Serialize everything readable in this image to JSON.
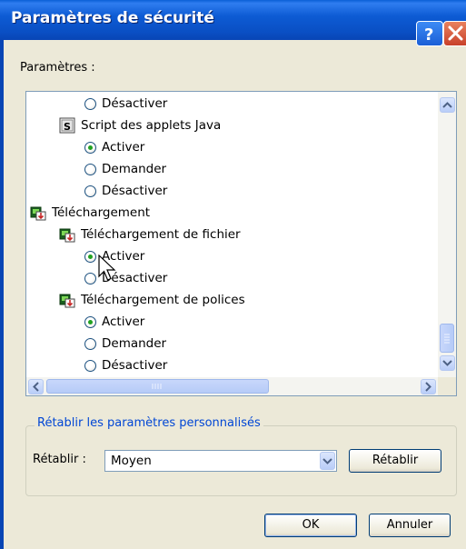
{
  "window": {
    "title": "Paramètres de sécurité"
  },
  "title_buttons": {
    "help": "help-icon",
    "close": "close-icon"
  },
  "settings_label": "Paramètres :",
  "tree": [
    {
      "kind": "radio",
      "label": "Désactiver",
      "checked": false,
      "indent": 1
    },
    {
      "kind": "category",
      "label": "Script des applets Java",
      "icon": "script-icon",
      "indent": 0
    },
    {
      "kind": "radio",
      "label": "Activer",
      "checked": true,
      "indent": 1
    },
    {
      "kind": "radio",
      "label": "Demander",
      "checked": false,
      "indent": 1
    },
    {
      "kind": "radio",
      "label": "Désactiver",
      "checked": false,
      "indent": 1
    },
    {
      "kind": "category",
      "label": "Téléchargement",
      "icon": "download-icon",
      "indent": -1
    },
    {
      "kind": "category",
      "label": "Téléchargement de fichier",
      "icon": "download-icon",
      "indent": 0
    },
    {
      "kind": "radio",
      "label": "Activer",
      "checked": true,
      "indent": 1
    },
    {
      "kind": "radio",
      "label": "Désactiver",
      "checked": false,
      "indent": 1
    },
    {
      "kind": "category",
      "label": "Téléchargement de polices",
      "icon": "download-icon",
      "indent": 0
    },
    {
      "kind": "radio",
      "label": "Activer",
      "checked": true,
      "indent": 1
    },
    {
      "kind": "radio",
      "label": "Demander",
      "checked": false,
      "indent": 1
    },
    {
      "kind": "radio",
      "label": "Désactiver",
      "checked": false,
      "indent": 1
    }
  ],
  "reset_group": {
    "title": "Rétablir les paramètres personnalisés",
    "label": "Rétablir :",
    "selected": "Moyen",
    "button": "Rétablir"
  },
  "buttons": {
    "ok": "OK",
    "cancel": "Annuler"
  },
  "colors": {
    "titlebar": "#0a5fd6",
    "accent": "#0046d5",
    "radio_check": "#21a121"
  }
}
